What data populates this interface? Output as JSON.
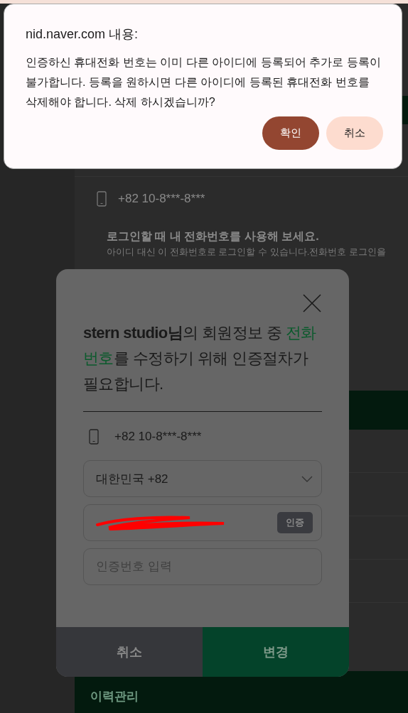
{
  "alert": {
    "title": "nid.naver.com 내용:",
    "message": "인증하신 휴대전화 번호는 이미 다른 아이디에 등록되어 추가로 등록이 불가합니다. 등록을 원하시면 다른 아이디에 등록된 휴대전화 번호를 삭제해야 합니다. 삭제 하시겠습니까?",
    "buttons": [
      {
        "label": "확인",
        "kind": "primary"
      },
      {
        "label": "취소",
        "kind": "secondary"
      }
    ]
  },
  "page": {
    "phone": "+82 10-8***-8***",
    "login_title": "로그인할 때 내 전화번호를 사용해 보세요.",
    "login_desc": "아이디 대신 이 전화번호로 로그인할 수 있습니다.전화번호 로그인을",
    "history_label": "이력관리"
  },
  "modal": {
    "message": [
      {
        "kind": "bold",
        "text": "stern studio님"
      },
      {
        "kind": "plain",
        "text": "의 회원정보 중 "
      },
      {
        "kind": "highlight",
        "text": "전화번호"
      },
      {
        "kind": "plain",
        "text": "를 수정하기 위해 인증절차가 필요합니다."
      }
    ],
    "phone": "+82 10-8***-8***",
    "country": "대한민국 +82",
    "phone_input": {
      "redacted": true
    },
    "verify_button": "인증",
    "code_placeholder": "인증번호 입력",
    "buttons": [
      {
        "label": "취소",
        "kind": "cancel"
      },
      {
        "label": "변경",
        "kind": "confirm"
      }
    ]
  }
}
